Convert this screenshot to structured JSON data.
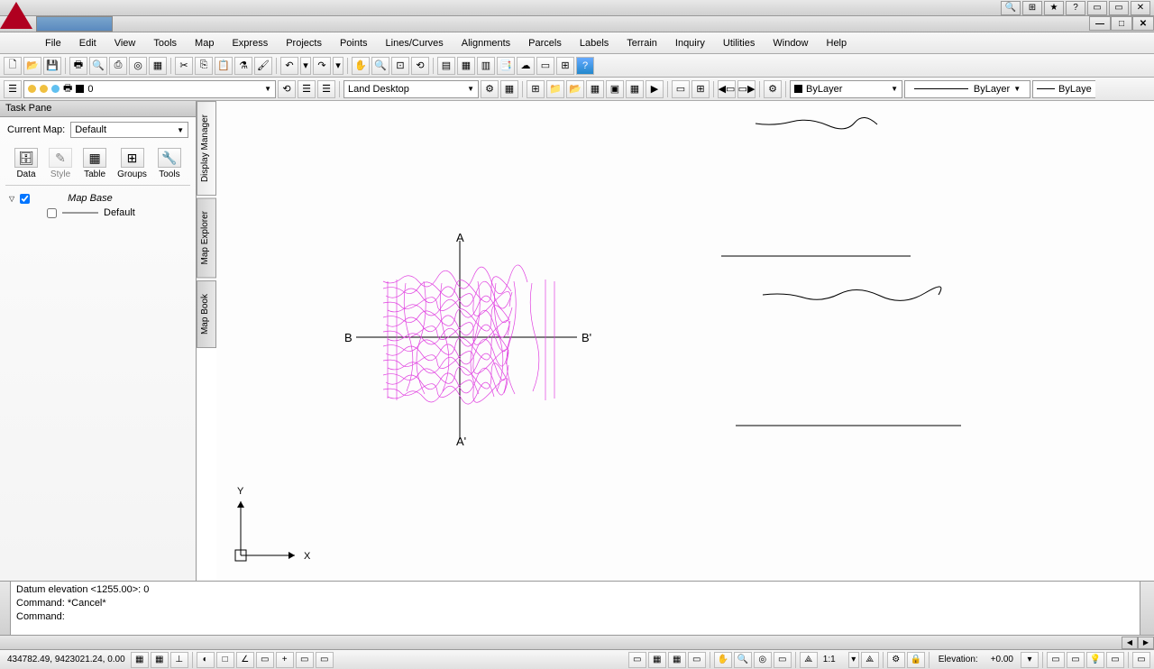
{
  "title_icons": [
    "🔍",
    "⊞",
    "★",
    "?",
    "▭",
    "▭",
    "✕"
  ],
  "win_buttons": [
    "—",
    "□",
    "✕"
  ],
  "menus": [
    "File",
    "Edit",
    "View",
    "Tools",
    "Map",
    "Express",
    "Projects",
    "Points",
    "Lines/Curves",
    "Alignments",
    "Parcels",
    "Labels",
    "Terrain",
    "Inquiry",
    "Utilities",
    "Window",
    "Help"
  ],
  "task_pane": {
    "title": "Task Pane",
    "current_map_label": "Current Map:",
    "current_map_value": "Default",
    "tools": [
      {
        "icon": "🗄",
        "label": "Data"
      },
      {
        "icon": "✎",
        "label": "Style"
      },
      {
        "icon": "▦",
        "label": "Table"
      },
      {
        "icon": "⊞",
        "label": "Groups"
      },
      {
        "icon": "🔧",
        "label": "Tools"
      }
    ],
    "tree": {
      "root": "Map Base",
      "child": "Default"
    }
  },
  "vert_tabs": [
    "Display Manager",
    "Map Explorer",
    "Map Book"
  ],
  "layer_combo": {
    "value": "0"
  },
  "workspace_combo": {
    "value": "Land Desktop"
  },
  "color_combo": {
    "value": "ByLayer"
  },
  "linetype_combo": {
    "value": "ByLayer"
  },
  "lineweight_combo": {
    "value": "ByLaye"
  },
  "command_lines": [
    "Datum elevation <1255.00>: 0",
    "Command: *Cancel*",
    "Command:"
  ],
  "status": {
    "coords": "434782.49, 9423021.24, 0.00",
    "scale": "1:1",
    "elevation_label": "Elevation:",
    "elevation_value": "+0.00"
  },
  "canvas_labels": {
    "A": "A",
    "Ap": "A'",
    "B": "B",
    "Bp": "B'",
    "X": "X",
    "Y": "Y"
  }
}
